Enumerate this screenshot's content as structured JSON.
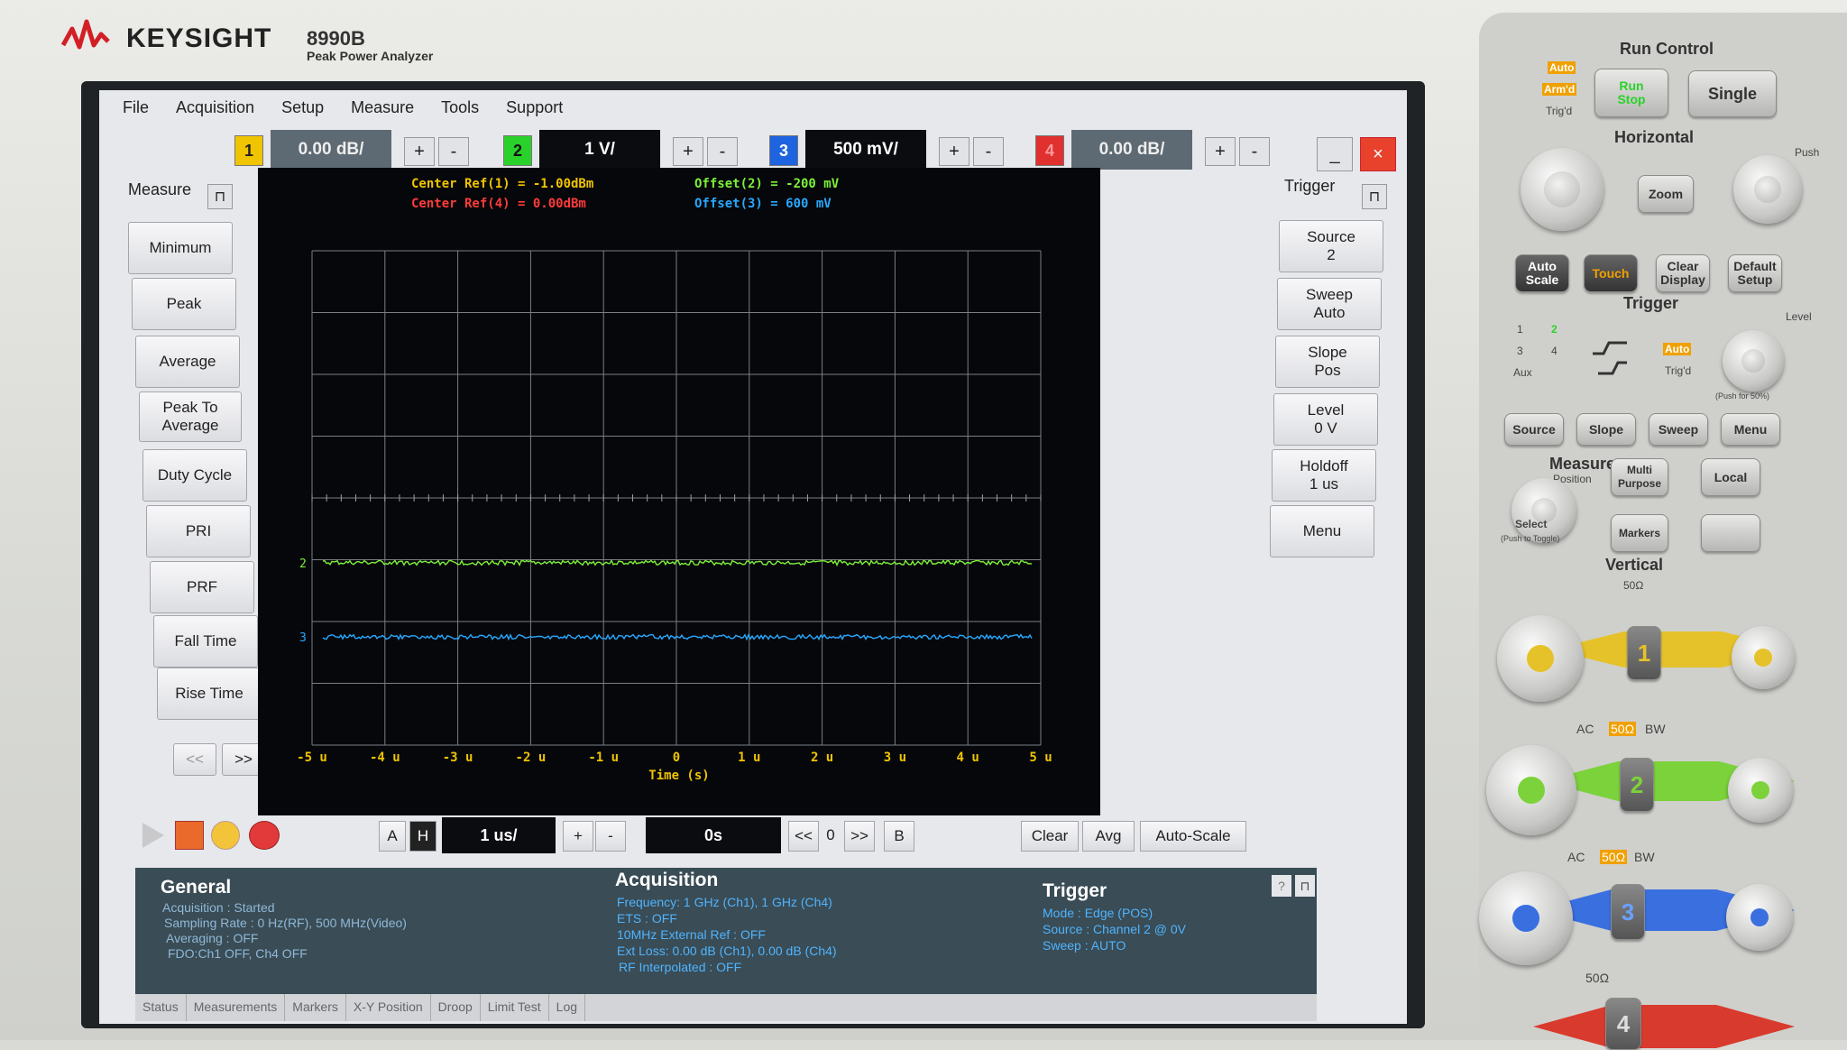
{
  "brand": {
    "name": "KEYSIGHT",
    "model": "8990B",
    "model_sub": "Peak Power Analyzer"
  },
  "menu": [
    "File",
    "Acquisition",
    "Setup",
    "Measure",
    "Tools",
    "Support"
  ],
  "channels": [
    {
      "num": "1",
      "value": "0.00 dB/",
      "color": "#f0c400"
    },
    {
      "num": "2",
      "value": "1 V/",
      "color": "#2bd12b"
    },
    {
      "num": "3",
      "value": "500 mV/",
      "color": "#1e63e0"
    },
    {
      "num": "4",
      "value": "0.00 dB/",
      "color": "#e03030"
    }
  ],
  "plus_label": "+",
  "minus_label": "-",
  "window": {
    "minimize": "_",
    "close": "×"
  },
  "measure": {
    "title": "Measure",
    "buttons": [
      "Minimum",
      "Peak",
      "Average",
      "Peak To Average",
      "Duty Cycle",
      "PRI",
      "PRF",
      "Fall Time",
      "Rise Time"
    ],
    "prev": "<<",
    "next": ">>"
  },
  "trigger": {
    "title": "Trigger",
    "buttons": [
      {
        "label": "Source",
        "value": "2"
      },
      {
        "label": "Sweep",
        "value": "Auto"
      },
      {
        "label": "Slope",
        "value": "Pos"
      },
      {
        "label": "Level",
        "value": "0 V"
      },
      {
        "label": "Holdoff",
        "value": "1 us"
      },
      {
        "label": "Menu",
        "value": ""
      }
    ]
  },
  "readouts": {
    "center_ref_1": "Center Ref(1) = -1.00dBm",
    "center_ref_4": "Center Ref(4) = 0.00dBm",
    "offset_2": "Offset(2) = -200 mV",
    "offset_3": "Offset(3) = 600 mV"
  },
  "chart_data": {
    "type": "line",
    "xlabel": "Time (s)",
    "x_ticks": [
      "-5 u",
      "-4 u",
      "-3 u",
      "-2 u",
      "-1 u",
      "0",
      "1 u",
      "2 u",
      "3 u",
      "4 u",
      "5 u"
    ],
    "xlim": [
      -5,
      5
    ],
    "grid": true,
    "series": [
      {
        "name": "2",
        "color": "#7cf03a",
        "level": 2.95
      },
      {
        "name": "3",
        "color": "#28a8ff",
        "level": 1.75
      }
    ]
  },
  "bottom": {
    "a": "A",
    "h": "H",
    "timebase": "1 us/",
    "plus": "+",
    "minus": "-",
    "delay": "0s",
    "prev": "<<",
    "zero": "0",
    "next": ">>",
    "b": "B",
    "clear": "Clear",
    "avg": "Avg",
    "autoscale": "Auto-Scale"
  },
  "info": {
    "general_title": "General",
    "general": [
      "Acquisition : Started",
      "Sampling Rate : 0 Hz(RF), 500 MHz(Video)",
      "Averaging : OFF",
      "FDO:Ch1 OFF, Ch4 OFF"
    ],
    "acq_title": "Acquisition",
    "acq": [
      "Frequency: 1 GHz (Ch1), 1 GHz (Ch4)",
      "ETS : OFF",
      "10MHz External Ref : OFF",
      "Ext Loss: 0.00 dB (Ch1), 0.00 dB (Ch4)",
      "RF Interpolated : OFF"
    ],
    "trig_title": "Trigger",
    "trig": [
      "Mode : Edge (POS)",
      "Source : Channel 2 @ 0V",
      "Sweep : AUTO"
    ],
    "help": "?"
  },
  "tabs": [
    "Status",
    "Measurements",
    "Markers",
    "X-Y Position",
    "Droop",
    "Limit Test",
    "Log"
  ],
  "panel": {
    "run_control": "Run Control",
    "auto": "Auto",
    "armd": "Arm'd",
    "trigd": "Trig'd",
    "run": "Run",
    "stop": "Stop",
    "single": "Single",
    "horizontal": "Horizontal",
    "push": "Push",
    "zoom": "Zoom",
    "auto_scale": "Auto Scale",
    "touch": "Touch",
    "clear_display": "Clear Display",
    "default_setup": "Default Setup",
    "trigger": "Trigger",
    "level": "Level",
    "src_nums": [
      "1",
      "2",
      "3",
      "4"
    ],
    "aux": "Aux",
    "auto2": "Auto",
    "trigd2": "Trig'd",
    "push_50": "(Push for 50%)",
    "source": "Source",
    "slope": "Slope",
    "sweep": "Sweep",
    "menu": "Menu",
    "measure": "Measure",
    "position": "Position",
    "multi_purpose": "Multi Purpose",
    "local": "Local",
    "select": "Select",
    "push_toggle": "(Push to Toggle)",
    "markers": "Markers",
    "vertical": "Vertical",
    "ohm": "50Ω",
    "ac": "AC",
    "bw": "BW",
    "ch_labels": [
      "1",
      "2",
      "3",
      "4"
    ]
  }
}
